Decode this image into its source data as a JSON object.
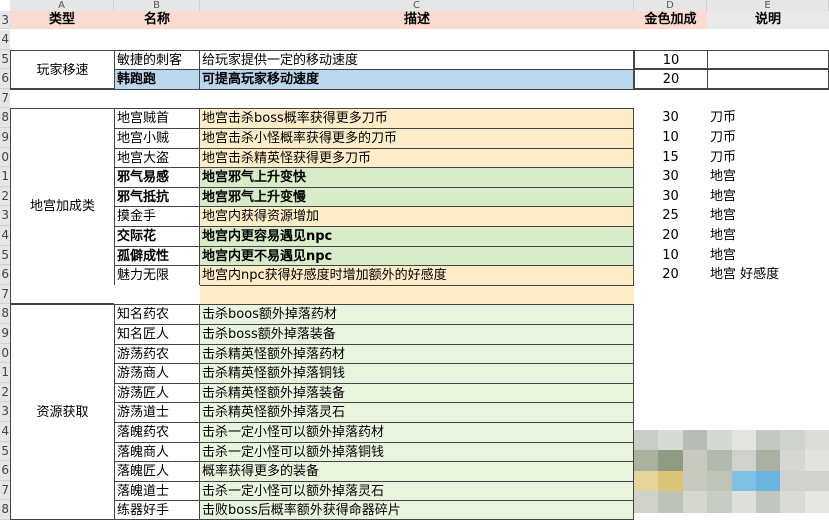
{
  "columns": [
    "A",
    "B",
    "C",
    "D",
    "E"
  ],
  "header": {
    "type": "类型",
    "name": "名称",
    "desc": "描述",
    "gold": "金色加成",
    "note": "说明"
  },
  "rows": [
    {
      "num": "4"
    },
    {
      "num": "5",
      "type": "玩家移速",
      "name": "敏捷的刺客",
      "desc": "给玩家提供一定的移动速度",
      "gold": "10",
      "note": "",
      "style": "plain"
    },
    {
      "num": "6",
      "name": "韩跑跑",
      "desc": "可提高玩家移动速度",
      "gold": "20",
      "note": "",
      "style": "blue",
      "bold": true
    },
    {
      "num": "7"
    },
    {
      "num": "8",
      "type": "地宫加成类",
      "name": "地宫贼首",
      "desc": "地宫击杀boss概率获得更多刀币",
      "gold": "30",
      "note": "刀币",
      "style": "orange"
    },
    {
      "num": "9",
      "name": "地宫小贼",
      "desc": "地宫击杀小怪概率获得更多的刀币",
      "gold": "10",
      "note": "刀币",
      "style": "orange"
    },
    {
      "num": "0",
      "name": "地宫大盗",
      "desc": "地宫击杀精英怪获得更多刀币",
      "gold": "15",
      "note": "刀币",
      "style": "orange"
    },
    {
      "num": "1",
      "name": "邪气易感",
      "desc": "地宫邪气上升变快",
      "gold": "30",
      "note": "地宫",
      "style": "green",
      "bold": true
    },
    {
      "num": "2",
      "name": "邪气抵抗",
      "desc": "地宫邪气上升变慢",
      "gold": "30",
      "note": "地宫",
      "style": "green",
      "bold": true
    },
    {
      "num": "3",
      "name": "摸金手",
      "desc": "地宫内获得资源增加",
      "gold": "25",
      "note": "地宫",
      "style": "orange"
    },
    {
      "num": "4",
      "name": "交际花",
      "desc": "地宫内更容易遇见npc",
      "gold": "20",
      "note": "地宫",
      "style": "green",
      "bold": true
    },
    {
      "num": "5",
      "name": "孤僻成性",
      "desc": "地宫内更不易遇见npc",
      "gold": "10",
      "note": "地宫",
      "style": "green",
      "bold": true
    },
    {
      "num": "6",
      "name": "魅力无限",
      "desc": "地宫内npc获得好感度时增加额外的好感度",
      "gold": "20",
      "note": "地宫  好感度",
      "style": "orange"
    },
    {
      "num": "7",
      "style": "emptyorange"
    },
    {
      "num": "8",
      "type": "资源获取",
      "name": "知名药农",
      "desc": "击杀boos额外掉落药材",
      "style": "lightgreen"
    },
    {
      "num": "9",
      "name": "知名匠人",
      "desc": "击杀boss额外掉落装备",
      "style": "lightgreen"
    },
    {
      "num": "0",
      "name": "游荡药农",
      "desc": "击杀精英怪额外掉落药材",
      "style": "lightgreen"
    },
    {
      "num": "1",
      "name": "游荡商人",
      "desc": "击杀精英怪额外掉落铜钱",
      "style": "lightgreen"
    },
    {
      "num": "2",
      "name": "游荡匠人",
      "desc": "击杀精英怪额外掉落装备",
      "style": "lightgreen"
    },
    {
      "num": "3",
      "name": "游荡道士",
      "desc": "击杀精英怪额外掉落灵石",
      "style": "lightgreen"
    },
    {
      "num": "4",
      "name": "落魄药农",
      "desc": "击杀一定小怪可以额外掉落药材",
      "style": "lightgreen"
    },
    {
      "num": "5",
      "name": "落魄商人",
      "desc": "击杀一定小怪可以额外掉落铜钱",
      "style": "lightgreen"
    },
    {
      "num": "6",
      "name": "落魄匠人",
      "desc": "概率获得更多的装备",
      "style": "lightgreen"
    },
    {
      "num": "7",
      "name": "落魄道士",
      "desc": "击杀一定小怪可以额外掉落灵石",
      "style": "lightgreen"
    },
    {
      "num": "8",
      "name": "练器好手",
      "desc": "击败boss后概率额外获得命器碎片",
      "style": "lightgreen"
    }
  ],
  "colors": {
    "header": "#fadbd2",
    "orange": "#fdecc8",
    "green": "#d9ecc9",
    "lightgreen": "#e9f4df",
    "blue": "#bcd6ee",
    "noteHeader": "#e9e9e9"
  }
}
